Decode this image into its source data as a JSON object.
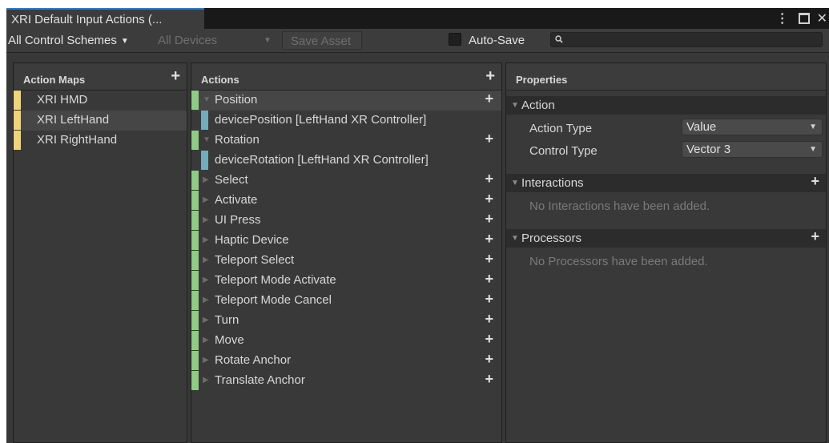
{
  "window": {
    "tab_title": "XRI Default Input Actions (..."
  },
  "toolbar": {
    "control_scheme": "All Control Schemes",
    "devices": "All Devices",
    "save_asset": "Save Asset",
    "auto_save_label": "Auto-Save",
    "auto_save_checked": false,
    "search_value": ""
  },
  "action_maps": {
    "title": "Action Maps",
    "items": [
      {
        "label": "XRI HMD",
        "selected": false
      },
      {
        "label": "XRI LeftHand",
        "selected": true
      },
      {
        "label": "XRI RightHand",
        "selected": false
      }
    ]
  },
  "actions": {
    "title": "Actions",
    "items": [
      {
        "label": "Position",
        "kind": "action",
        "expanded": true,
        "selected": true
      },
      {
        "label": "devicePosition [LeftHand XR Controller]",
        "kind": "binding"
      },
      {
        "label": "Rotation",
        "kind": "action",
        "expanded": true
      },
      {
        "label": "deviceRotation [LeftHand XR Controller]",
        "kind": "binding"
      },
      {
        "label": "Select",
        "kind": "action",
        "expanded": false
      },
      {
        "label": "Activate",
        "kind": "action",
        "expanded": false
      },
      {
        "label": "UI Press",
        "kind": "action",
        "expanded": false
      },
      {
        "label": "Haptic Device",
        "kind": "action",
        "expanded": false
      },
      {
        "label": "Teleport Select",
        "kind": "action",
        "expanded": false
      },
      {
        "label": "Teleport Mode Activate",
        "kind": "action",
        "expanded": false
      },
      {
        "label": "Teleport Mode Cancel",
        "kind": "action",
        "expanded": false
      },
      {
        "label": "Turn",
        "kind": "action",
        "expanded": false
      },
      {
        "label": "Move",
        "kind": "action",
        "expanded": false
      },
      {
        "label": "Rotate Anchor",
        "kind": "action",
        "expanded": false
      },
      {
        "label": "Translate Anchor",
        "kind": "action",
        "expanded": false
      }
    ]
  },
  "properties": {
    "title": "Properties",
    "action_section": "Action",
    "action_type_label": "Action Type",
    "action_type_value": "Value",
    "control_type_label": "Control Type",
    "control_type_value": "Vector 3",
    "interactions_section": "Interactions",
    "interactions_empty": "No Interactions have been added.",
    "processors_section": "Processors",
    "processors_empty": "No Processors have been added."
  },
  "colors": {
    "map_bar": "#f2d37c",
    "action_bar": "#8fcb85",
    "binding_bar": "#77aab9",
    "tab_accent": "#3a79bb"
  }
}
